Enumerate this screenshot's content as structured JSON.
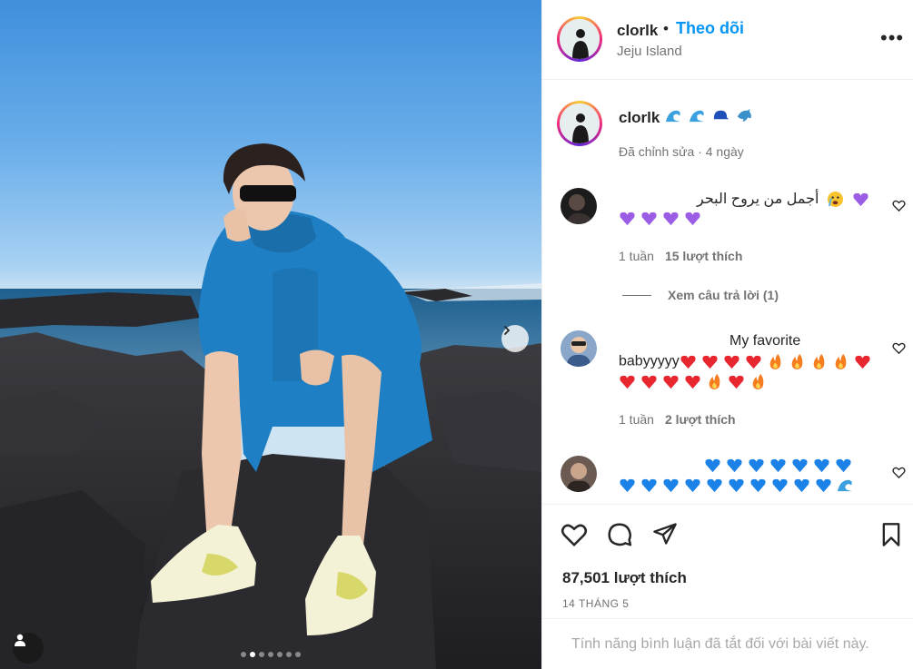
{
  "post": {
    "username": "clorlk",
    "follow_label": "Theo dõi",
    "bullet": "•",
    "location": "Jeju Island",
    "more_label": "•••",
    "photo_count": 7,
    "active_photo_index": 1
  },
  "caption": {
    "username": "clorlk",
    "emojis": [
      "wave-emoji",
      "wave-emoji",
      "cap-emoji",
      "dolphin-emoji"
    ],
    "meta": "Đã chỉnh sửa · 4 ngày"
  },
  "comments": [
    {
      "text": "أجمل من يروح البحر",
      "time": "1 tuần",
      "likes": "15 lượt thích",
      "replies": "Xem câu trả lời (1)"
    },
    {
      "text_line1": "My favorite",
      "text_line2": "babyyyyy",
      "time": "1 tuần",
      "likes": "2 lượt thích"
    },
    {
      "emojis": "blue-hearts-wave"
    }
  ],
  "footer": {
    "likes": "87,501 lượt thích",
    "date": "14 THÁNG 5",
    "comments_disabled": "Tính năng bình luận đã tắt đối với bài viết này."
  },
  "colors": {
    "accent": "#0095f6",
    "muted": "#737373",
    "jacket": "#1f7fc4"
  }
}
